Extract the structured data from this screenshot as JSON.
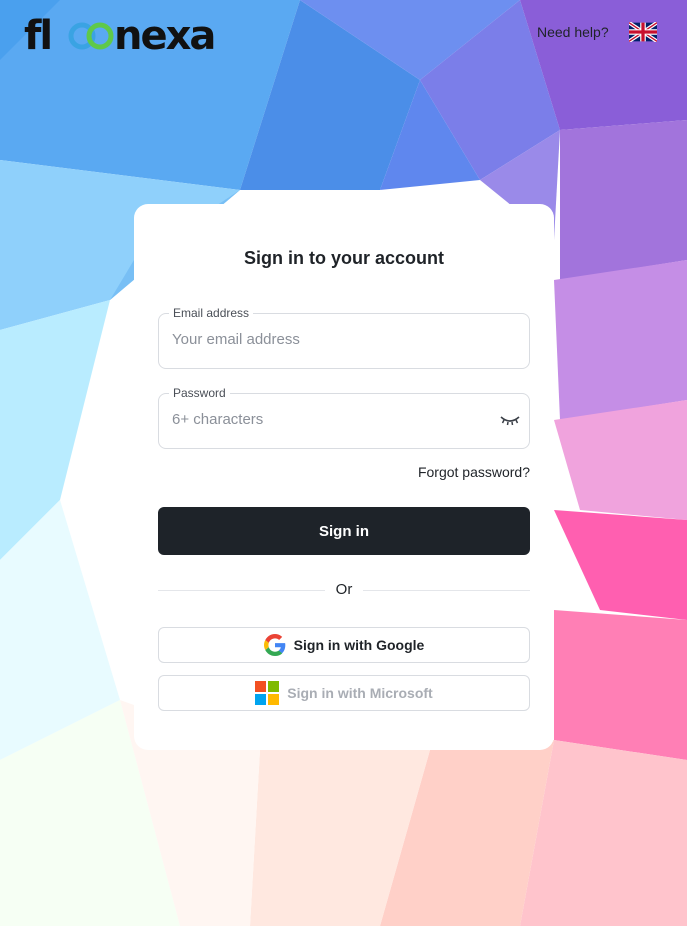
{
  "header": {
    "logo_text": "floonexa",
    "help_link": "Need help?",
    "language_flag_icon": "uk-flag-icon"
  },
  "card": {
    "title": "Sign in to your account",
    "email": {
      "label": "Email address",
      "placeholder": "Your email address",
      "value": ""
    },
    "password": {
      "label": "Password",
      "placeholder": "6+ characters",
      "value": "",
      "toggle_icon": "eye-closed-icon"
    },
    "forgot_password": "Forgot password?",
    "signin_button": "Sign in",
    "divider_text": "Or",
    "google_button": "Sign in with Google",
    "microsoft_button": "Sign in with Microsoft"
  },
  "colors": {
    "primary_button": "#1e2329",
    "logo_text": "#111111",
    "logo_rings": [
      "#3aa3e3",
      "#5fc94a"
    ],
    "microsoft_disabled_text": "#a9adb4"
  }
}
